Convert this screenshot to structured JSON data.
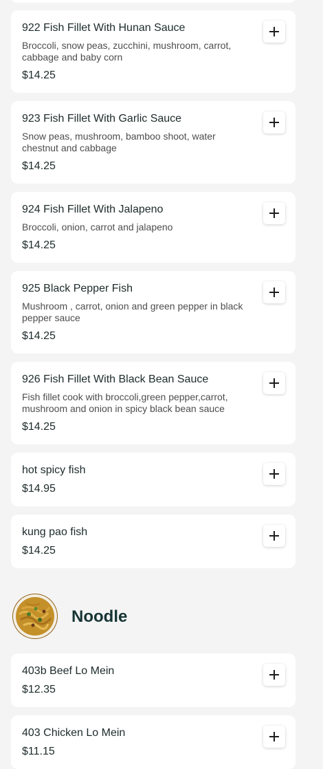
{
  "items": [
    {
      "name": "922 Fish Fillet With Hunan Sauce",
      "description": "Broccoli, snow peas, zucchini, mushroom, carrot, cabbage and baby corn",
      "price": "$14.25"
    },
    {
      "name": "923 Fish Fillet With Garlic Sauce",
      "description": "Snow peas, mushroom, bamboo shoot, water chestnut and cabbage",
      "price": "$14.25"
    },
    {
      "name": "924 Fish Fillet With Jalapeno",
      "description": "Broccoli, onion, carrot and jalapeno",
      "price": "$14.25"
    },
    {
      "name": "925 Black Pepper Fish",
      "description": "Mushroom , carrot, onion and green pepper in black pepper sauce",
      "price": "$14.25"
    },
    {
      "name": "926 Fish Fillet With Black Bean Sauce",
      "description": "Fish fillet cook with broccoli,green pepper,carrot, mushroom and onion in spicy black bean sauce",
      "price": "$14.25"
    },
    {
      "name": "hot spicy fish",
      "description": "",
      "price": "$14.95"
    },
    {
      "name": "kung pao fish",
      "description": "",
      "price": "$14.25"
    }
  ],
  "section": {
    "title": "Noodle"
  },
  "noodle_items": [
    {
      "name": "403b Beef Lo Mein",
      "price": "$12.35"
    },
    {
      "name": "403 Chicken Lo Mein",
      "price": "$11.15"
    }
  ],
  "icons": {
    "add": "plus-icon"
  },
  "colors": {
    "background": "#f4f4f4",
    "card": "#ffffff",
    "title": "#163434"
  }
}
